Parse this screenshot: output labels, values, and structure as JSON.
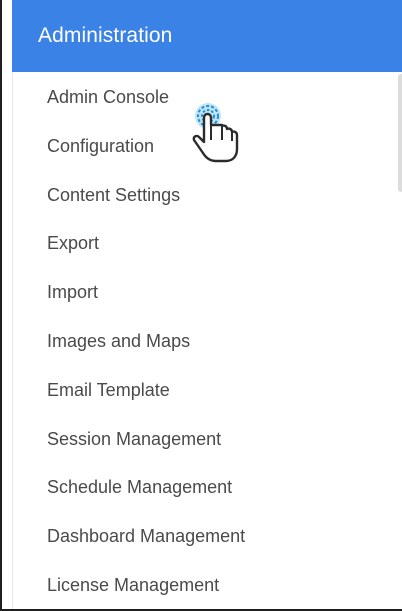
{
  "panel": {
    "title": "Administration",
    "header_color": "#3b82e6"
  },
  "menu": {
    "items": [
      {
        "label": "Admin Console"
      },
      {
        "label": "Configuration"
      },
      {
        "label": "Content Settings"
      },
      {
        "label": "Export"
      },
      {
        "label": "Import"
      },
      {
        "label": "Images and Maps"
      },
      {
        "label": "Email Template"
      },
      {
        "label": "Session Management"
      },
      {
        "label": "Schedule Management"
      },
      {
        "label": "Dashboard Management"
      },
      {
        "label": "License Management"
      }
    ]
  },
  "pointer": {
    "icon": "hand-pointer-icon"
  }
}
